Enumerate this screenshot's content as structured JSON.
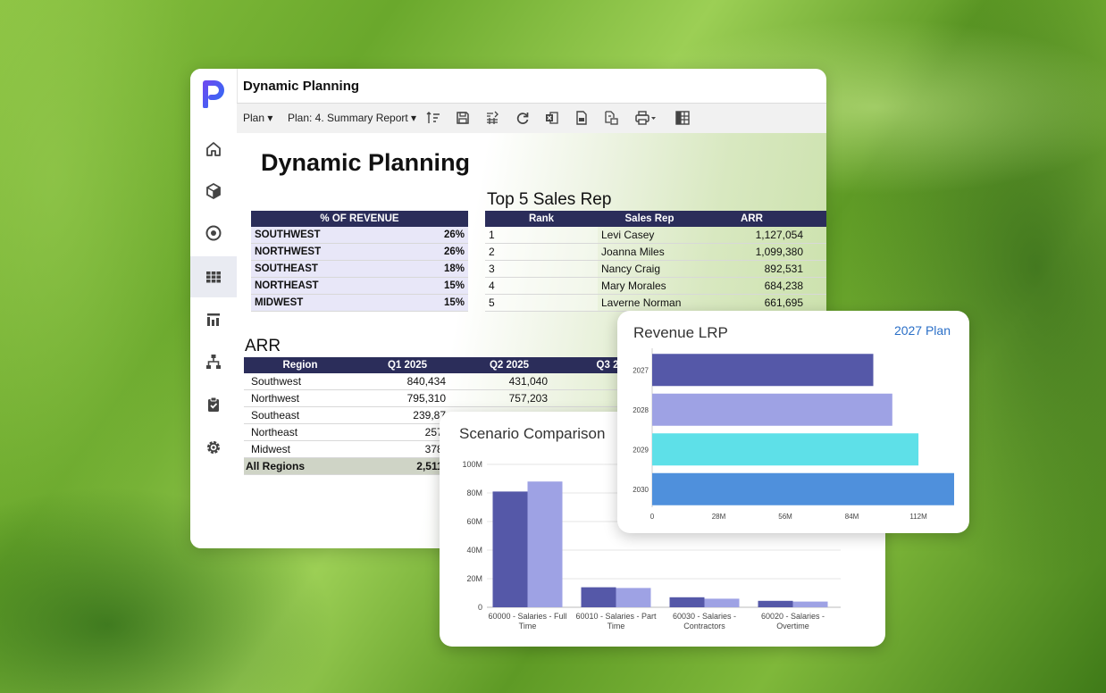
{
  "app": {
    "title": "Dynamic Planning"
  },
  "sidebar": {
    "items": [
      {
        "name": "home",
        "icon": "home-icon"
      },
      {
        "name": "models",
        "icon": "cube-icon"
      },
      {
        "name": "target",
        "icon": "target-icon"
      },
      {
        "name": "grid",
        "icon": "grid-icon",
        "active": true
      },
      {
        "name": "reports",
        "icon": "bar-chart-icon"
      },
      {
        "name": "hierarchy",
        "icon": "hierarchy-icon"
      },
      {
        "name": "tasks",
        "icon": "clipboard-icon"
      },
      {
        "name": "settings",
        "icon": "gear-icon"
      }
    ]
  },
  "toolbar": {
    "plan_menu": "Plan ▾",
    "report_menu": "Plan: 4. Summary Report ▾"
  },
  "report": {
    "title": "Dynamic Planning",
    "revenue_pct": {
      "header": "% OF REVENUE",
      "rows": [
        {
          "region": "SOUTHWEST",
          "pct": "26%"
        },
        {
          "region": "NORTHWEST",
          "pct": "26%"
        },
        {
          "region": "SOUTHEAST",
          "pct": "18%"
        },
        {
          "region": "NORTHEAST",
          "pct": "15%"
        },
        {
          "region": "MIDWEST",
          "pct": "15%"
        }
      ]
    },
    "top5": {
      "title": "Top 5 Sales Rep",
      "columns": [
        "Rank",
        "Sales Rep",
        "ARR"
      ],
      "rows": [
        {
          "rank": "1",
          "rep": "Levi Casey",
          "arr": "1,127,054"
        },
        {
          "rank": "2",
          "rep": "Joanna Miles",
          "arr": "1,099,380"
        },
        {
          "rank": "3",
          "rep": "Nancy Craig",
          "arr": "892,531"
        },
        {
          "rank": "4",
          "rep": "Mary Morales",
          "arr": "684,238"
        },
        {
          "rank": "5",
          "rep": "Laverne Norman",
          "arr": "661,695"
        }
      ]
    },
    "arr": {
      "title": "ARR",
      "columns": [
        "Region",
        "Q1 2025",
        "Q2 2025",
        "Q3 2"
      ],
      "rows": [
        {
          "region": "Southwest",
          "q1": "840,434",
          "q2": "431,040"
        },
        {
          "region": "Northwest",
          "q1": "795,310",
          "q2": "757,203"
        },
        {
          "region": "Southeast",
          "q1": "239,87",
          "q2": ""
        },
        {
          "region": "Northeast",
          "q1": "257,",
          "q2": ""
        },
        {
          "region": "Midwest",
          "q1": "378,",
          "q2": ""
        }
      ],
      "total": {
        "region": "All Regions",
        "q1": "2,511,"
      }
    }
  },
  "scenario_card": {
    "title": "Scenario Comparison",
    "colors": {
      "series1": "#5558a8",
      "series2": "#9ea2e4"
    }
  },
  "lrp_card": {
    "title": "Revenue LRP",
    "link": "2027 Plan"
  },
  "chart_data": [
    {
      "type": "bar",
      "title": "Scenario Comparison",
      "categories": [
        "60000 - Salaries - Full Time",
        "60010 - Salaries - Part Time",
        "60030 - Salaries - Contractors",
        "60020 - Salaries - Overtime"
      ],
      "category_lines": [
        [
          "60000 - Salaries - Full",
          "Time"
        ],
        [
          "60010 - Salaries - Part",
          "Time"
        ],
        [
          "60030 - Salaries -",
          "Contractors"
        ],
        [
          "60020 - Salaries -",
          "Overtime"
        ]
      ],
      "series": [
        {
          "values": [
            81,
            14,
            7,
            4.5
          ],
          "color": "#5558a8"
        },
        {
          "values": [
            88,
            13.5,
            6,
            4
          ],
          "color": "#9ea2e4"
        }
      ],
      "ylim": [
        0,
        100
      ],
      "yticks": [
        "0",
        "20M",
        "40M",
        "60M",
        "80M",
        "100M"
      ],
      "grid": true
    },
    {
      "type": "bar",
      "orientation": "horizontal",
      "title": "Revenue LRP",
      "categories": [
        "2027",
        "2028",
        "2029",
        "2030"
      ],
      "values": [
        93,
        101,
        112,
        127
      ],
      "colors": [
        "#5558a8",
        "#9ea2e4",
        "#5ee0e8",
        "#4f90dc"
      ],
      "xlim": [
        0,
        127
      ],
      "xticks": [
        "0",
        "28M",
        "56M",
        "84M",
        "112M"
      ]
    }
  ]
}
